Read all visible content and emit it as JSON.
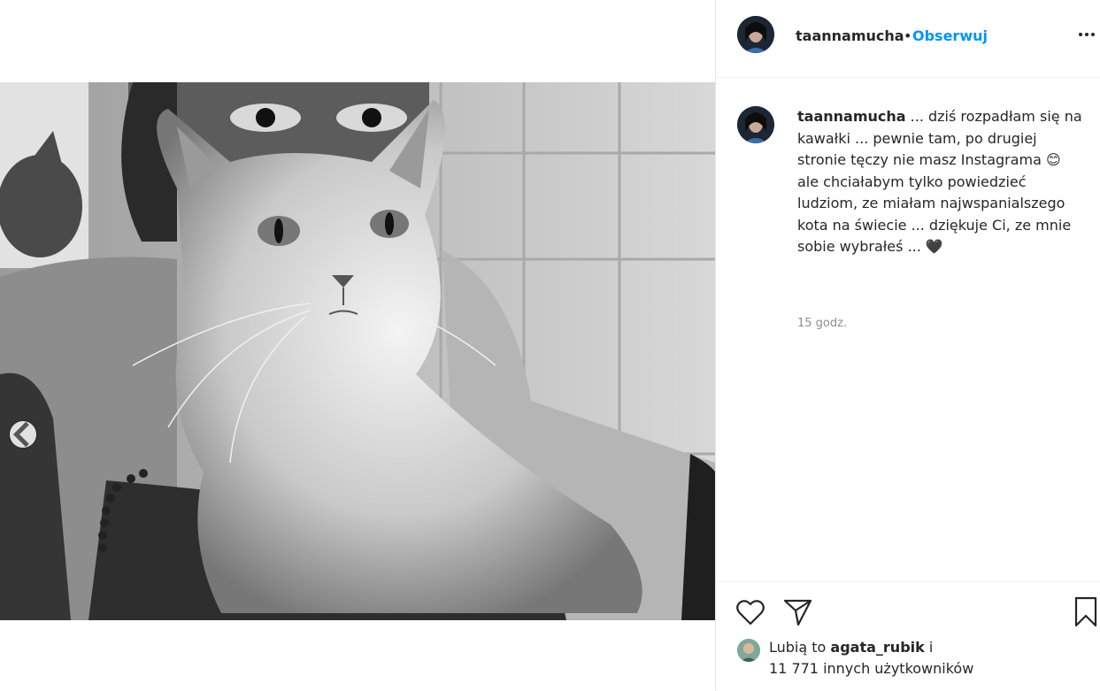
{
  "post": {
    "username": "taannamucha",
    "separator": "•",
    "follow_label": "Obserwuj",
    "more_icon": "more-horizontal-icon"
  },
  "caption": {
    "username": "taannamucha",
    "text": "... dziś rozpadłam się na kawałki ... pewnie tam, po drugiej stronie tęczy nie masz Instagrama 😊 ale chciałabym tylko powiedzieć ludziom, ze miałam najwspanialszego kota na świecie ... dziękuje Ci, ze mnie sobie wybrałeś ... 🖤",
    "time": "15 godz."
  },
  "actions": {
    "like_icon": "heart-icon",
    "share_icon": "send-icon",
    "save_icon": "bookmark-icon",
    "carousel_icon": "chevron-left-icon"
  },
  "likes": {
    "prefix": "Lubią to",
    "user": "agata_rubik",
    "suffix": "i",
    "others": "11 771 innych użytkowników"
  },
  "colors": {
    "accent": "#0095f6",
    "text": "#262626",
    "muted": "#8e8e8e"
  }
}
